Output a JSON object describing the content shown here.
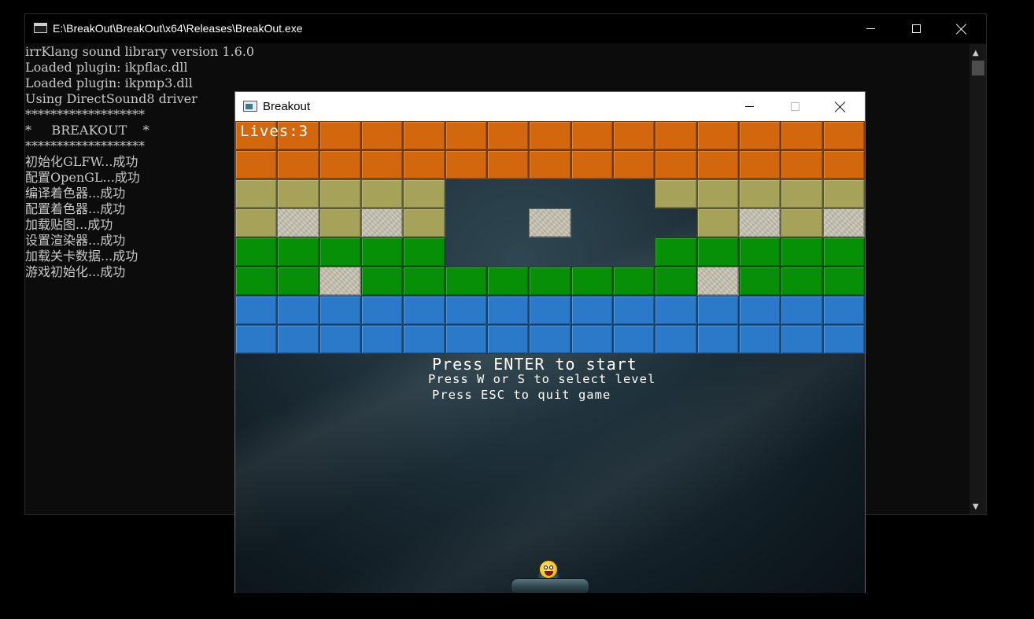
{
  "console": {
    "title": "E:\\BreakOut\\BreakOut\\x64\\Releases\\BreakOut.exe",
    "lines": [
      "irrKlang sound library version 1.6.0",
      "Loaded plugin: ikpflac.dll",
      "Loaded plugin: ikpmp3.dll",
      "Using DirectSound8 driver",
      "*******************",
      "*     BREAKOUT    *",
      "*******************",
      "初始化GLFW...成功",
      "配置OpenGL...成功",
      "编译着色器...成功",
      "配置着色器...成功",
      "加载贴图...成功",
      "设置渲染器...成功",
      "加载关卡数据...成功",
      "游戏初始化...成功"
    ]
  },
  "game": {
    "title": "Breakout",
    "lives_text": "Lives:3",
    "messages": {
      "start": "Press ENTER to start",
      "level": "Press W or S to select level",
      "quit": "Press ESC to quit game"
    },
    "level": {
      "columns": 15,
      "rows": [
        "111111111111111",
        "111111111111111",
        "222220000022222",
        "2S2S200S0002S2S",
        "333330000033333",
        "33S33333333S333"
      ],
      "bottom_rows": [
        "444444444444444",
        "444444444444444"
      ],
      "legend": {
        "0": "empty",
        "S": "solid (indestructible)",
        "1": "orange",
        "2": "olive",
        "3": "green",
        "4": "blue"
      }
    },
    "colors": {
      "1": "#d2670e",
      "2": "#a6a25a",
      "3": "#079007",
      "4": "#2b79c9",
      "S": "#c6c1b0"
    }
  }
}
